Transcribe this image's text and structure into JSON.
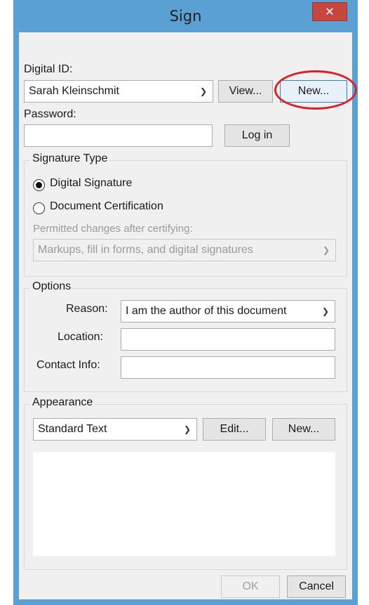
{
  "window": {
    "title": "Sign",
    "close_glyph": "✕"
  },
  "digital_id": {
    "label": "Digital ID:",
    "selected": "Sarah Kleinschmit",
    "view_label": "View...",
    "new_label": "New..."
  },
  "password": {
    "label": "Password:",
    "value": "",
    "login_label": "Log in"
  },
  "signature_type": {
    "legend": "Signature Type",
    "options": [
      {
        "label": "Digital Signature",
        "checked": true
      },
      {
        "label": "Document Certification",
        "checked": false
      }
    ],
    "permitted_label": "Permitted changes after certifying:",
    "permitted_selected": "Markups, fill in forms, and digital signatures"
  },
  "options": {
    "legend": "Options",
    "reason_label": "Reason:",
    "reason_selected": "I am the author of this document",
    "location_label": "Location:",
    "location_value": "",
    "contact_label": "Contact Info:",
    "contact_value": ""
  },
  "appearance": {
    "legend": "Appearance",
    "selected": "Standard Text",
    "edit_label": "Edit...",
    "new_label": "New..."
  },
  "footer": {
    "ok_label": "OK",
    "cancel_label": "Cancel"
  },
  "icons": {
    "dropdown": "chevron-down-icon",
    "close": "close-icon"
  },
  "colors": {
    "titlebar": "#5aa0d3",
    "close_button": "#c7463d",
    "annotation": "#d8212b",
    "client_bg": "#f0f0f0"
  }
}
